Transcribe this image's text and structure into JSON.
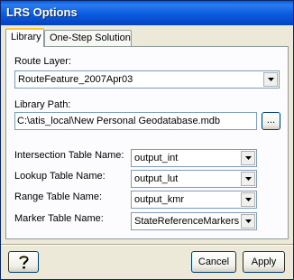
{
  "window": {
    "title": "LRS Options"
  },
  "tabs": [
    {
      "label": "Library",
      "active": true
    },
    {
      "label": "One-Step Solution",
      "active": false
    }
  ],
  "library": {
    "route_layer": {
      "label": "Route Layer:",
      "value": "RouteFeature_2007Apr03"
    },
    "library_path": {
      "label": "Library Path:",
      "value": "C:\\atis_local\\New Personal Geodatabase.mdb",
      "browse_label": "..."
    },
    "intersection_table": {
      "label": "Intersection Table Name:",
      "value": "output_int"
    },
    "lookup_table": {
      "label": "Lookup Table Name:",
      "value": "output_lut"
    },
    "range_table": {
      "label": "Range Table Name:",
      "value": "output_kmr"
    },
    "marker_table": {
      "label": "Marker Table Name:",
      "value": "StateReferenceMarkers"
    }
  },
  "footer": {
    "help_icon": "question-mark-icon",
    "cancel_label": "Cancel",
    "apply_label": "Apply"
  },
  "colors": {
    "titlebar": "#0A58D8",
    "dialog_bg": "#ECE9D8",
    "tab_highlight": "#FFC83C"
  }
}
